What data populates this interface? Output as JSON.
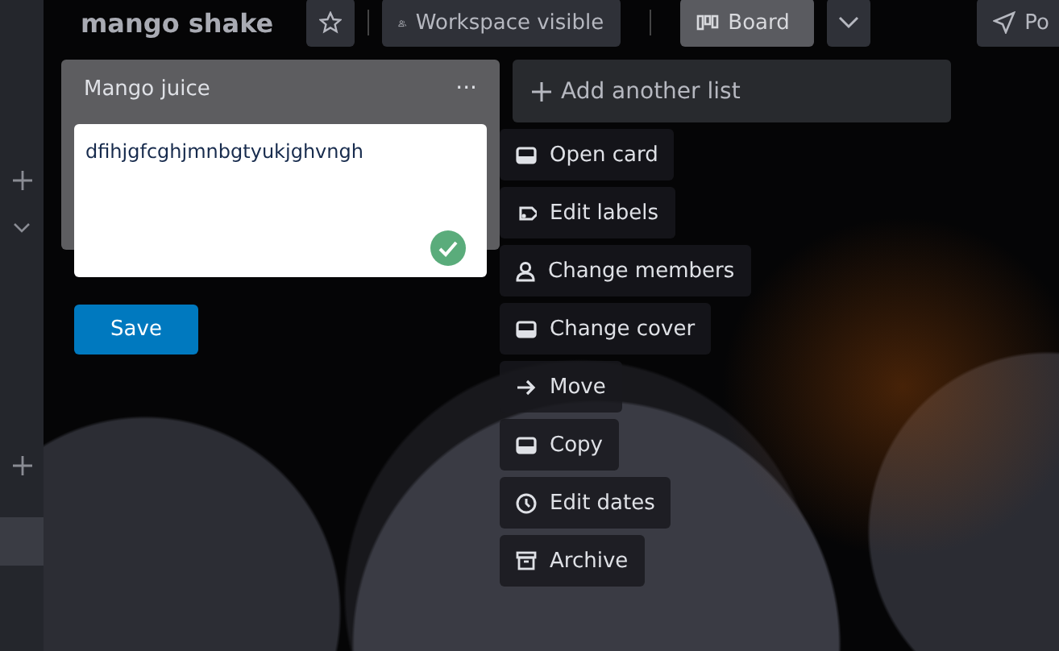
{
  "header": {
    "board_title": "mango shake",
    "workspace_visibility": "Workspace visible",
    "view": "Board",
    "cut_button": "Po"
  },
  "list": {
    "title": "Mango juice",
    "menu_glyph": "···",
    "editor": {
      "value": "dfihjgfcghjmnbgtyukjghvngh"
    },
    "save": "Save"
  },
  "add_list": "Add another list",
  "card_menu": [
    {
      "label": "Open card"
    },
    {
      "label": "Edit labels"
    },
    {
      "label": "Change members"
    },
    {
      "label": "Change cover"
    },
    {
      "label": "Move"
    },
    {
      "label": "Copy"
    },
    {
      "label": "Edit dates"
    },
    {
      "label": "Archive"
    }
  ]
}
